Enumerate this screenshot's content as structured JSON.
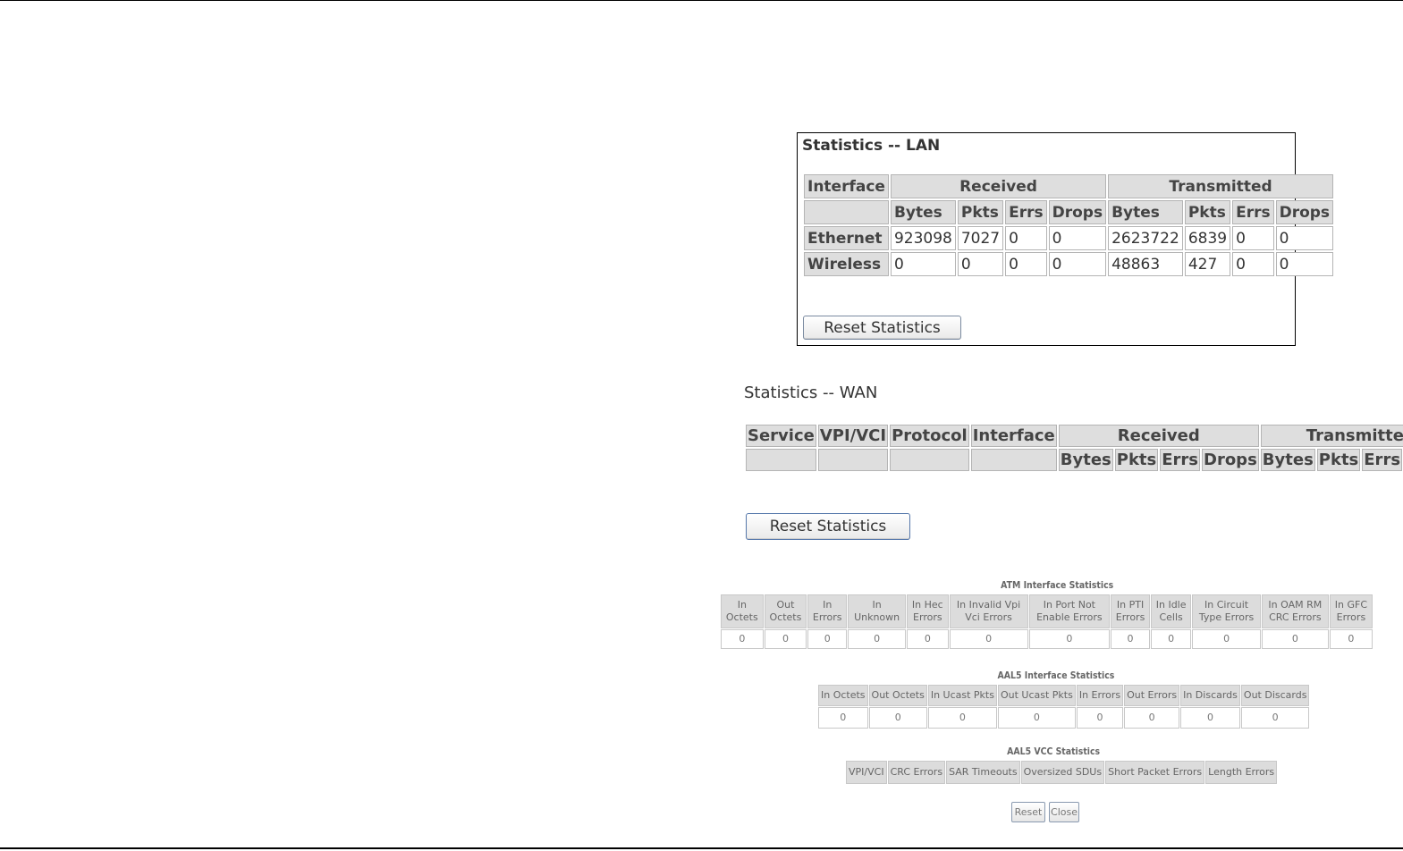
{
  "lan": {
    "title": "Statistics -- LAN",
    "headers": {
      "interface": "Interface",
      "received": "Received",
      "transmitted": "Transmitted",
      "bytes": "Bytes",
      "pkts": "Pkts",
      "errs": "Errs",
      "drops": "Drops"
    },
    "rows": [
      {
        "name": "Ethernet",
        "rx_bytes": "923098",
        "rx_pkts": "7027",
        "rx_errs": "0",
        "rx_drops": "0",
        "tx_bytes": "2623722",
        "tx_pkts": "6839",
        "tx_errs": "0",
        "tx_drops": "0"
      },
      {
        "name": "Wireless",
        "rx_bytes": "0",
        "rx_pkts": "0",
        "rx_errs": "0",
        "rx_drops": "0",
        "tx_bytes": "48863",
        "tx_pkts": "427",
        "tx_errs": "0",
        "tx_drops": "0"
      }
    ],
    "reset_label": "Reset Statistics"
  },
  "wan": {
    "title": "Statistics -- WAN",
    "headers": {
      "service": "Service",
      "vpivci": "VPI/VCI",
      "protocol": "Protocol",
      "interface": "Interface",
      "received": "Received",
      "transmitted": "Transmitted",
      "bytes": "Bytes",
      "pkts": "Pkts",
      "errs": "Errs",
      "drops": "Drops"
    },
    "reset_label": "Reset Statistics"
  },
  "atm": {
    "title": "ATM Interface Statistics",
    "headers": [
      [
        "In",
        "Octets"
      ],
      [
        "Out",
        "Octets"
      ],
      [
        "In",
        "Errors"
      ],
      [
        "In",
        "Unknown"
      ],
      [
        "In Hec",
        "Errors"
      ],
      [
        "In Invalid Vpi",
        "Vci Errors"
      ],
      [
        "In Port Not",
        "Enable Errors"
      ],
      [
        "In PTI",
        "Errors"
      ],
      [
        "In Idle",
        "Cells"
      ],
      [
        "In Circuit",
        "Type Errors"
      ],
      [
        "In OAM RM",
        "CRC Errors"
      ],
      [
        "In GFC",
        "Errors"
      ]
    ],
    "values": [
      "0",
      "0",
      "0",
      "0",
      "0",
      "0",
      "0",
      "0",
      "0",
      "0",
      "0",
      "0"
    ]
  },
  "aal5": {
    "title": "AAL5 Interface Statistics",
    "headers": [
      "In Octets",
      "Out Octets",
      "In Ucast Pkts",
      "Out Ucast Pkts",
      "In Errors",
      "Out Errors",
      "In Discards",
      "Out Discards"
    ],
    "values": [
      "0",
      "0",
      "0",
      "0",
      "0",
      "0",
      "0",
      "0"
    ]
  },
  "vcc": {
    "title": "AAL5 VCC Statistics",
    "headers": [
      "VPI/VCI",
      "CRC Errors",
      "SAR Timeouts",
      "Oversized SDUs",
      "Short Packet Errors",
      "Length Errors"
    ]
  },
  "atm_buttons": {
    "reset": "Reset",
    "close": "Close"
  }
}
